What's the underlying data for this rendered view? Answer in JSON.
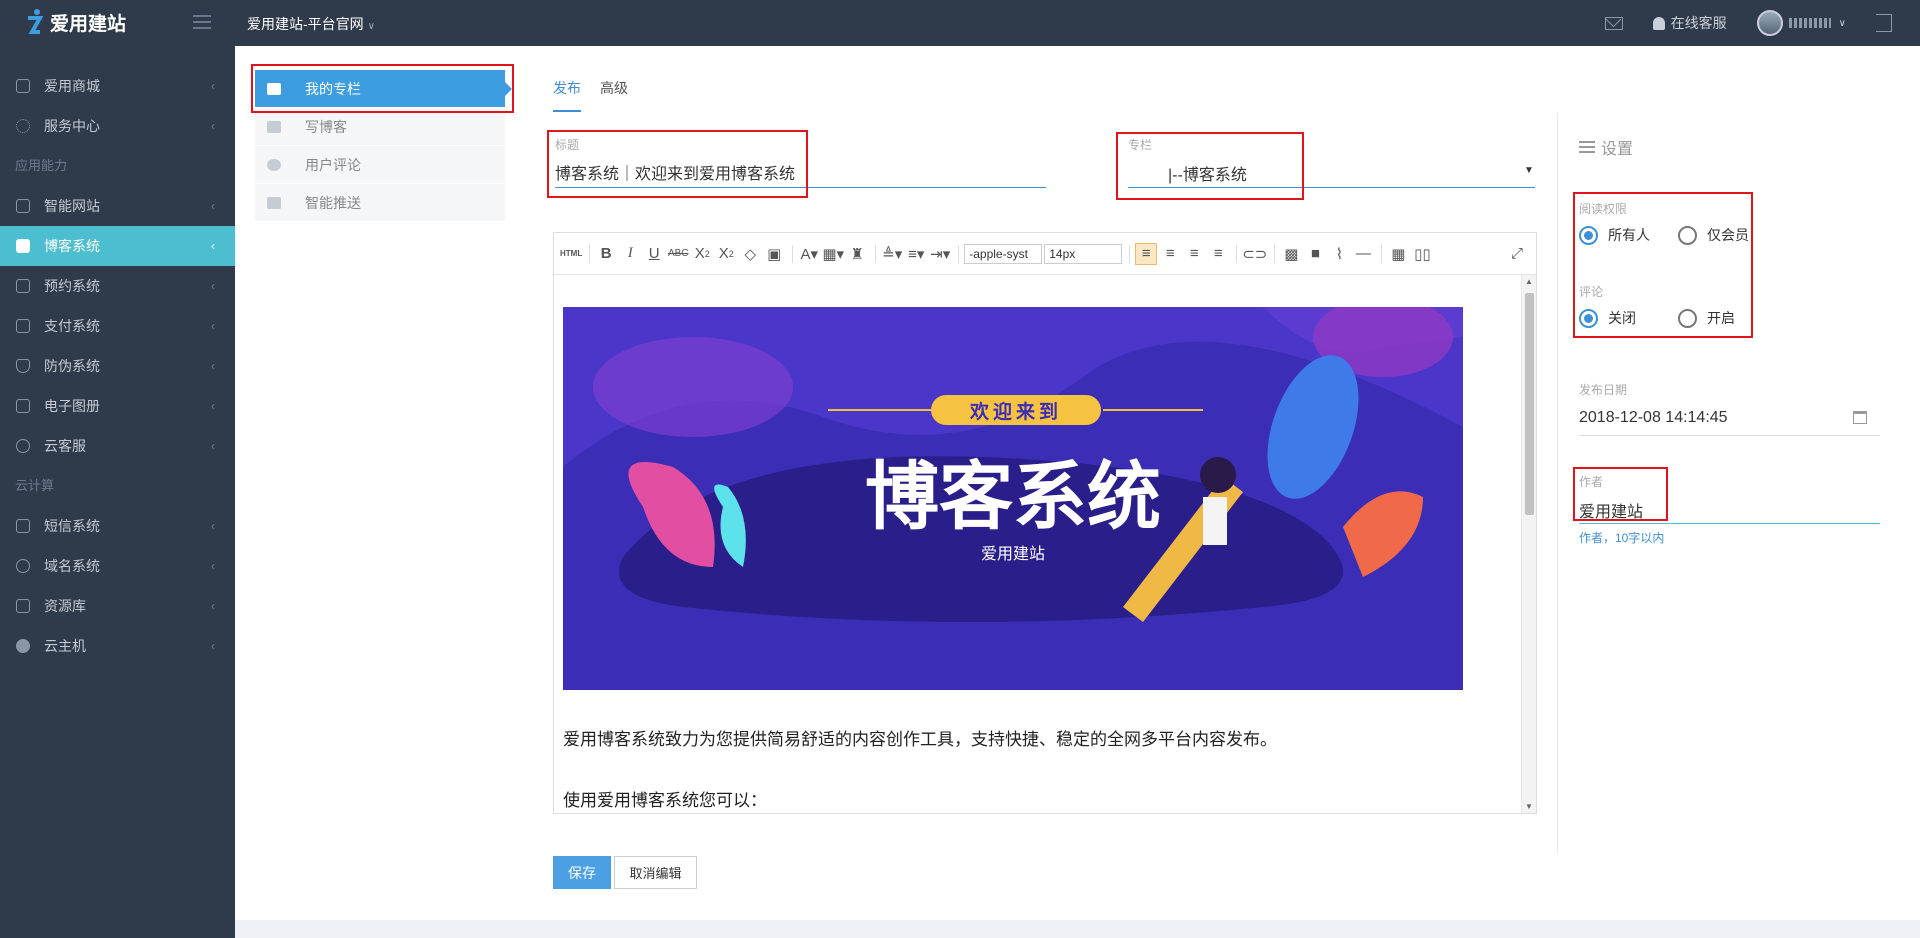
{
  "app": {
    "logo_text": "爱用建站",
    "site_switcher": "爱用建站-平台官网"
  },
  "topbar": {
    "service_label": "在线客服"
  },
  "sidebar": {
    "items": [
      {
        "label": "爱用商城",
        "icon": "cart-icon",
        "active": false
      },
      {
        "label": "服务中心",
        "icon": "spinner-icon",
        "active": false
      },
      {
        "group": "应用能力"
      },
      {
        "label": "智能网站",
        "icon": "laptop-icon",
        "active": false
      },
      {
        "label": "博客系统",
        "icon": "document-icon",
        "active": true
      },
      {
        "label": "预约系统",
        "icon": "calendar-check-icon",
        "active": false
      },
      {
        "label": "支付系统",
        "icon": "wallet-icon",
        "active": false
      },
      {
        "label": "防伪系统",
        "icon": "shield-icon",
        "active": false
      },
      {
        "label": "电子图册",
        "icon": "album-icon",
        "active": false
      },
      {
        "label": "云客服",
        "icon": "chat-icon",
        "active": false
      },
      {
        "group": "云计算"
      },
      {
        "label": "短信系统",
        "icon": "envelope-icon",
        "active": false
      },
      {
        "label": "域名系统",
        "icon": "globe-icon",
        "active": false
      },
      {
        "label": "资源库",
        "icon": "folder-icon",
        "active": false
      },
      {
        "label": "云主机",
        "icon": "cloud-icon",
        "active": false
      }
    ]
  },
  "subnav": {
    "items": [
      {
        "label": "我的专栏",
        "icon": "folder-open-icon",
        "active": true
      },
      {
        "label": "写博客",
        "icon": "edit-icon",
        "active": false
      },
      {
        "label": "用户评论",
        "icon": "comment-icon",
        "active": false
      },
      {
        "label": "智能推送",
        "icon": "share-icon",
        "active": false
      }
    ]
  },
  "tabs": [
    {
      "label": "发布",
      "active": true
    },
    {
      "label": "高级",
      "active": false
    }
  ],
  "form": {
    "title_label": "标题",
    "title_value": "博客系统｜欢迎来到爱用博客系统",
    "column_label": "专栏",
    "column_value": "|--博客系统"
  },
  "editor": {
    "font_family": "-apple-syst",
    "font_size": "14px",
    "banner": {
      "badge": "欢迎来到",
      "headline": "博客系统",
      "sub": "爱用建站"
    },
    "paragraphs": [
      "爱用博客系统致力为您提供简易舒适的内容创作工具，支持快捷、稳定的全网多平台内容发布。",
      "使用爱用博客系统您可以："
    ]
  },
  "settings": {
    "title": "设置",
    "read_permission_label": "阅读权限",
    "read_options": [
      {
        "label": "所有人",
        "checked": true
      },
      {
        "label": "仅会员",
        "checked": false
      }
    ],
    "comment_label": "评论",
    "comment_options": [
      {
        "label": "关闭",
        "checked": true
      },
      {
        "label": "开启",
        "checked": false
      }
    ],
    "publish_date_label": "发布日期",
    "publish_date_value": "2018-12-08 14:14:45",
    "author_label": "作者",
    "author_value": "爱用建站",
    "author_hint": "作者，10字以内"
  },
  "buttons": {
    "save": "保存",
    "cancel": "取消编辑"
  },
  "colors": {
    "sidebar_bg": "#2f3a4a",
    "active_teal": "#4dbecf",
    "accent_blue": "#3e9ce0",
    "highlight_red": "#e0151b"
  }
}
